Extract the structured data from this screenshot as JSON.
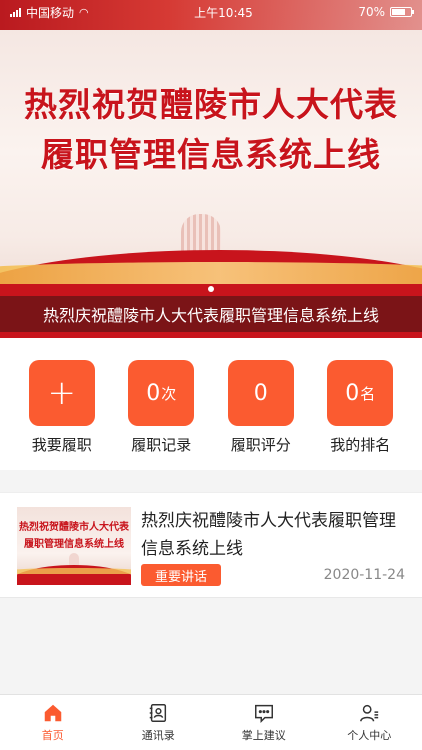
{
  "status_bar": {
    "carrier": "中国移动",
    "time": "上午10:45",
    "battery": "70%"
  },
  "banner": {
    "title_line1": "热烈祝贺醴陵市人大代表",
    "title_line2": "履职管理信息系统上线",
    "caption": "热烈庆祝醴陵市人大代表履职管理信息系统上线",
    "slide_count": 1,
    "active_slide": 1
  },
  "actions": [
    {
      "icon": "plus-icon",
      "value": "",
      "unit": "",
      "label": "我要履职"
    },
    {
      "icon": "",
      "value": "0",
      "unit": "次",
      "label": "履职记录"
    },
    {
      "icon": "",
      "value": "0",
      "unit": "",
      "label": "履职评分"
    },
    {
      "icon": "",
      "value": "0",
      "unit": "名",
      "label": "我的排名"
    }
  ],
  "news": [
    {
      "thumb_line1": "热烈祝贺醴陵市人大代表",
      "thumb_line2": "履职管理信息系统上线",
      "title": "热烈庆祝醴陵市人大代表履职管理信息系统上线",
      "tag": "重要讲话",
      "date": "2020-11-24"
    }
  ],
  "tab_bar": {
    "tabs": [
      {
        "label": "首页",
        "icon": "home-icon",
        "active": true
      },
      {
        "label": "通讯录",
        "icon": "contacts-icon",
        "active": false
      },
      {
        "label": "掌上建议",
        "icon": "suggestion-icon",
        "active": false
      },
      {
        "label": "个人中心",
        "icon": "user-icon",
        "active": false
      }
    ]
  },
  "colors": {
    "accent": "#fb5b30",
    "banner_red": "#c8141c",
    "inactive_tab": "#333333"
  }
}
